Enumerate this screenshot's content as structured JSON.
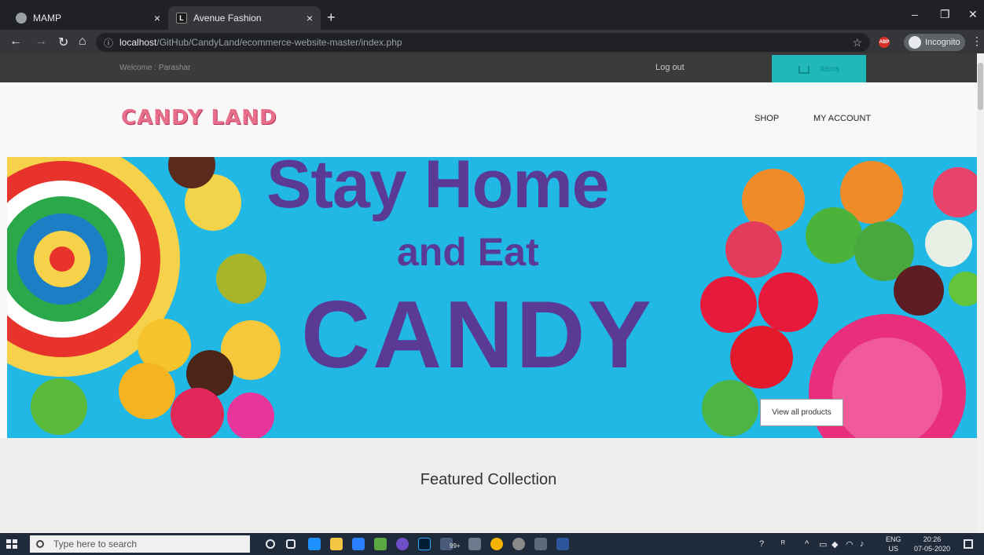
{
  "browser": {
    "tabs": [
      {
        "title": "MAMP",
        "favicon": "globe-icon"
      },
      {
        "title": "Avenue Fashion",
        "favicon": "letter-l-icon",
        "favicon_letter": "L"
      }
    ],
    "new_tab_symbol": "+",
    "close_symbol": "×",
    "url_host": "localhost",
    "url_path": "/GitHub/CandyLand/ecommerce-website-master/index.php",
    "profile_label": "Incognito",
    "extension_label": "ABP",
    "window_controls": [
      "–",
      "❐",
      "✕"
    ]
  },
  "site": {
    "welcome_text": "Welcome : Parashar",
    "logout_label": "Log out",
    "cart_label": "Items",
    "logo_text": "CANDY LAND",
    "nav": [
      {
        "label": "SHOP"
      },
      {
        "label": "MY ACCOUNT"
      }
    ],
    "hero": {
      "line1": "Stay Home",
      "line2": "and Eat",
      "line3": "CANDY",
      "button_label": "View all products"
    },
    "featured_title": "Featured Collection"
  },
  "colors": {
    "topstrip": "#3b3b3b",
    "cart_accent": "#20b8b8",
    "hero_bg": "#21b8e6",
    "hero_text": "#5a3a94",
    "logo": "#e76f8c"
  },
  "taskbar": {
    "search_placeholder": "Type here to search",
    "language_top": "ENG",
    "language_bottom": "US",
    "time": "20:26",
    "date": "07-05-2020",
    "badge_count": "99+"
  }
}
